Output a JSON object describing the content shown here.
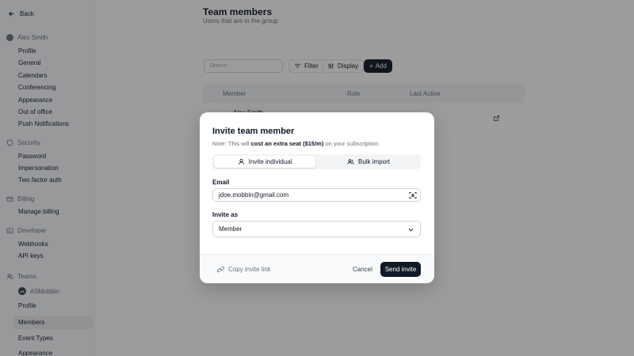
{
  "sidebar": {
    "back_label": "Back",
    "user_name": "Alex Smith",
    "account_items": [
      "Profile",
      "General",
      "Calendars",
      "Conferencing",
      "Appearance",
      "Out of office",
      "Push Notifications"
    ],
    "security_label": "Security",
    "security_items": [
      "Password",
      "Impersonation",
      "Two factor auth"
    ],
    "billing_label": "Billing",
    "billing_items": [
      "Manage billing"
    ],
    "developer_label": "Developer",
    "developer_items": [
      "Webhooks",
      "API keys"
    ],
    "teams_label": "Teams",
    "team_initials": "AS",
    "team_name": "ASMobbin",
    "team_items": [
      "Profile",
      "Members",
      "Event Types",
      "Appearance"
    ],
    "active_item": "Members"
  },
  "main": {
    "title": "Team members",
    "subtitle": "Users that are in the group",
    "search_placeholder": "Search",
    "filter_label": "Filter",
    "display_label": "Display",
    "add_label": "Add",
    "columns": [
      "Member",
      "Role",
      "Last Active"
    ],
    "row_name": "Alex Smith"
  },
  "modal": {
    "title": "Invite team member",
    "note_prefix": "Note: This will ",
    "note_bold": "cost an extra seat ($15/m)",
    "note_suffix": " on your subscription.",
    "tab_individual": "Invite individual",
    "tab_bulk": "Bulk import",
    "email_label": "Email",
    "email_value": "jdoe.mobbin@gmail.com",
    "invite_as_label": "Invite as",
    "invite_as_value": "Member",
    "copy_link_label": "Copy invite link",
    "cancel_label": "Cancel",
    "send_label": "Send invite"
  },
  "colors": {
    "primary_button": "#111827",
    "overlay": "rgba(20,20,20,0.42)"
  }
}
